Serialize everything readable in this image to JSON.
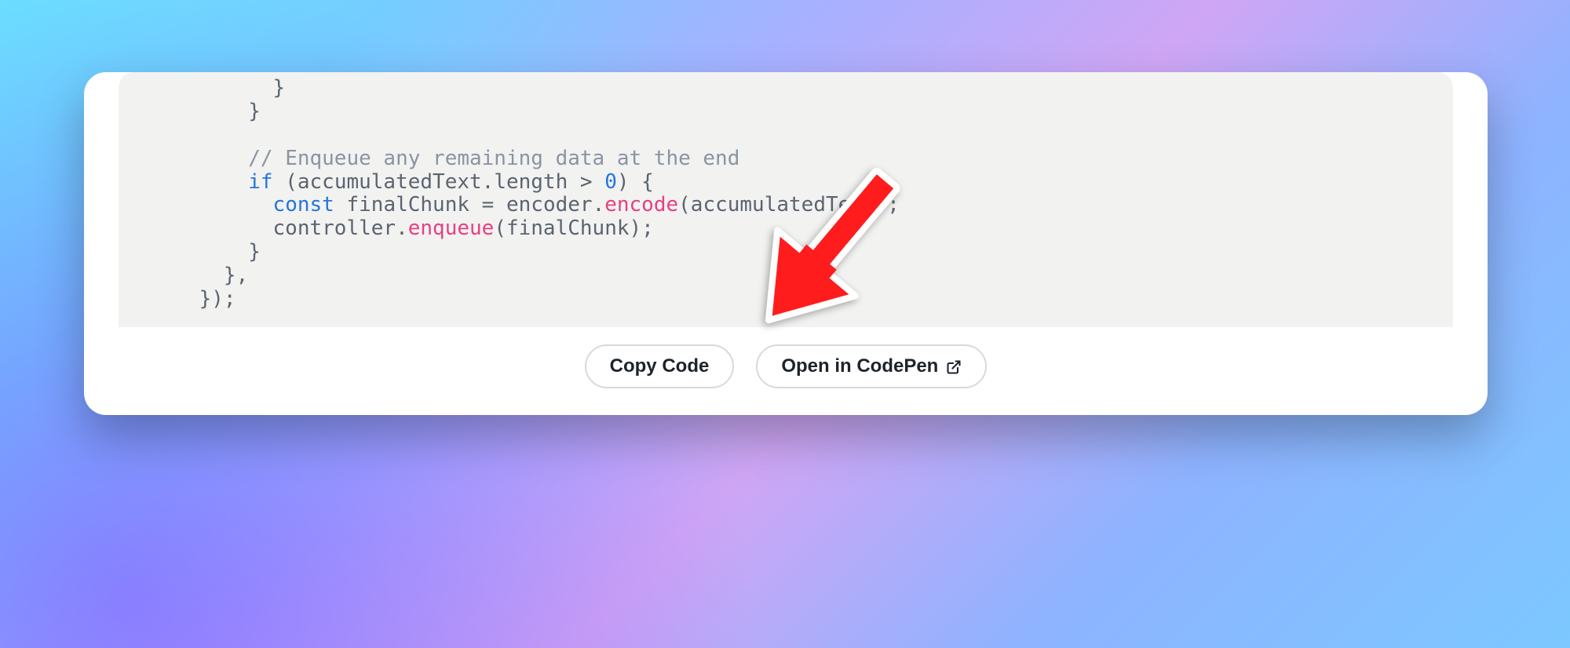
{
  "code": {
    "indent0": "          }",
    "indent1": "        }",
    "blank": "",
    "comment_indent": "        ",
    "comment": "// Enqueue any remaining data at the end",
    "if_indent": "        ",
    "if_kw": "if",
    "if_open": " (accumulatedText",
    "if_dot": ".",
    "if_length": "length",
    "if_gt": " > ",
    "if_zero": "0",
    "if_close": ") {",
    "const_indent": "          ",
    "const_kw": "const",
    "const_name": " finalChunk ",
    "const_eq": "= encoder",
    "const_dot": ".",
    "encode": "encode",
    "encode_args": "(accumulatedText);",
    "ctrl_indent": "          controller",
    "ctrl_dot": ".",
    "enqueue": "enqueue",
    "enqueue_args": "(finalChunk);",
    "close1": "        }",
    "close2": "      },",
    "close3": "    });"
  },
  "buttons": {
    "copy": "Copy Code",
    "open": "Open in CodePen"
  },
  "annotation": {
    "arrow_target": "open-in-codepen-button"
  }
}
